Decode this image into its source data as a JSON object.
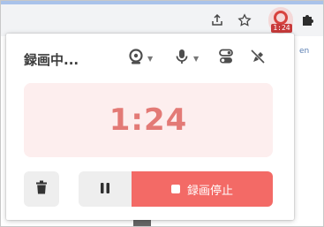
{
  "browser": {
    "extension_badge": "1:24",
    "background_snippet": "en",
    "icons": [
      "share-icon",
      "star-icon",
      "recorder-extension-icon",
      "puzzle-icon"
    ]
  },
  "popup": {
    "title": "録画中...",
    "icons": [
      "webcam-icon",
      "microphone-icon",
      "toggle-icon",
      "eye-dropper-off-icon"
    ],
    "timer": "1:24",
    "stop_label": "録画停止",
    "colors": {
      "accent": "#f36a66",
      "timer_text": "#e37a76",
      "timer_bg": "#fdeeee",
      "neutral_button": "#eeeeee"
    }
  }
}
